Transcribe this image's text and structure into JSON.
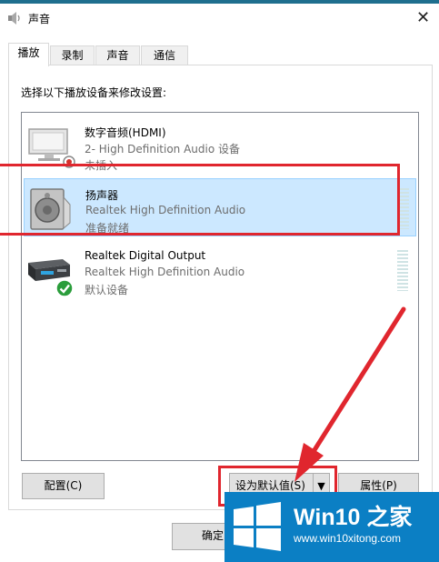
{
  "window": {
    "title": "声音",
    "icon": "speaker-icon",
    "close_glyph": "✕"
  },
  "tabs": [
    {
      "label": "播放",
      "active": true
    },
    {
      "label": "录制",
      "active": false
    },
    {
      "label": "声音",
      "active": false
    },
    {
      "label": "通信",
      "active": false
    }
  ],
  "prompt": "选择以下播放设备来修改设置:",
  "devices": [
    {
      "name": "数字音频(HDMI)",
      "desc": "2- High Definition Audio 设备",
      "status": "未插入",
      "icon": "monitor-icon",
      "badge": "unplugged-badge",
      "selected": false
    },
    {
      "name": "扬声器",
      "desc": "Realtek High Definition Audio",
      "status": "准备就绪",
      "icon": "speaker-device-icon",
      "badge": "",
      "selected": true
    },
    {
      "name": "Realtek Digital Output",
      "desc": "Realtek High Definition Audio",
      "status": "默认设备",
      "icon": "digital-output-icon",
      "badge": "default-check-badge",
      "selected": false
    }
  ],
  "buttons": {
    "configure": "配置(C)",
    "set_default": "设为默认值(S)",
    "set_default_arrow": "▼",
    "properties": "属性(P)",
    "ok": "确定"
  },
  "watermark": {
    "brand": "Win10 之家",
    "url": "www.win10xitong.com"
  },
  "colors": {
    "selection": "#cce8ff",
    "annotation_red": "#e0262e",
    "watermark_blue": "#0b7fc4"
  }
}
